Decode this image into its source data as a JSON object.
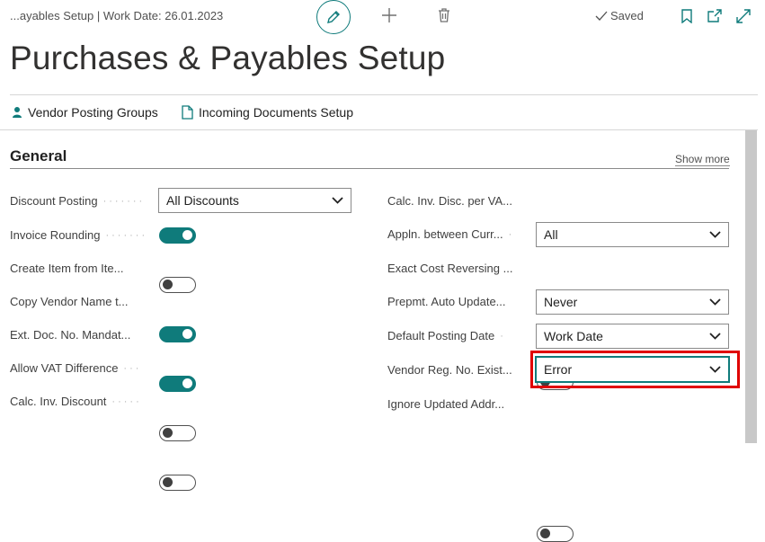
{
  "header": {
    "title": "...ayables Setup | Work Date: 26.01.2023",
    "saved_label": "Saved",
    "icons": [
      "pencil-icon",
      "plus-icon",
      "trash-icon",
      "checkmark-icon",
      "bookmark-icon",
      "open-new-window-icon",
      "expand-icon"
    ]
  },
  "page_title": "Purchases & Payables Setup",
  "actions": [
    {
      "label": "Vendor Posting Groups",
      "icon": "person-icon"
    },
    {
      "label": "Incoming Documents Setup",
      "icon": "document-icon"
    }
  ],
  "section": {
    "title": "General",
    "show_more": "Show more"
  },
  "left_fields": [
    {
      "label": "Discount Posting",
      "type": "select",
      "value": "All Discounts"
    },
    {
      "label": "Invoice Rounding",
      "type": "toggle",
      "value": true
    },
    {
      "label": "Create Item from Ite...",
      "type": "toggle",
      "value": false
    },
    {
      "label": "Copy Vendor Name t...",
      "type": "toggle",
      "value": true
    },
    {
      "label": "Ext. Doc. No. Mandat...",
      "type": "toggle",
      "value": true
    },
    {
      "label": "Allow VAT Difference",
      "type": "toggle",
      "value": false
    },
    {
      "label": "Calc. Inv. Discount",
      "type": "toggle",
      "value": false
    }
  ],
  "right_fields": [
    {
      "label": "Calc. Inv. Disc. per VA...",
      "type": "toggle",
      "value": false
    },
    {
      "label": "Appln. between Curr...",
      "type": "select",
      "value": "All"
    },
    {
      "label": "Exact Cost Reversing ...",
      "type": "toggle",
      "value": false
    },
    {
      "label": "Prepmt. Auto Update...",
      "type": "select",
      "value": "Never"
    },
    {
      "label": "Default Posting Date",
      "type": "select",
      "value": "Work Date"
    },
    {
      "label": "Vendor Reg. No. Exist...",
      "type": "select",
      "value": "Error",
      "highlighted": true
    },
    {
      "label": "Ignore Updated Addr...",
      "type": "toggle",
      "value": false
    }
  ],
  "colors": {
    "accent": "#0f7b7b",
    "highlight_box": "#e00000"
  }
}
